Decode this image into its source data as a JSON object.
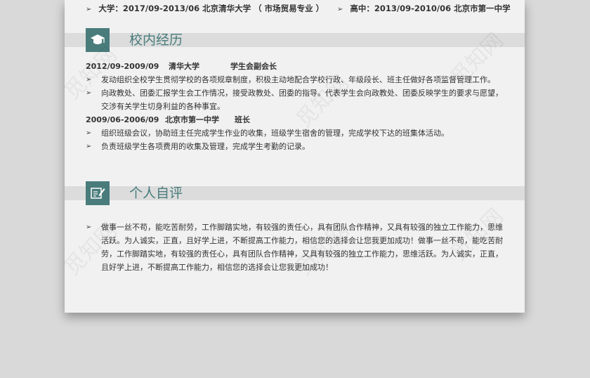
{
  "education": {
    "university": "大学：2017/09-2013/06    北京清华大学 （ 市场贸易专业 ）",
    "highschool": "高中：2013/09-2010/06    北京市第一中学"
  },
  "campus": {
    "title": "校内经历",
    "icon": "graduation-cap-icon",
    "entry1": {
      "date": "2012/09-2009/09",
      "org": "清华大学",
      "role": "学生会副会长",
      "bullets": [
        "发动组织全校学生贯彻学校的各项规章制度，积极主动地配合学校行政、年级段长、班主任做好各项监督管理工作。",
        "向政教处、团委汇报学生会工作情况，接受政教处、团委的指导。代表学生会向政教处、团委反映学生的要求与愿望，",
        "交涉有关学生切身利益的各种事宜。"
      ]
    },
    "entry2": {
      "date": "2009/06-2006/09",
      "org": "北京市第一中学",
      "role": "班长",
      "bullets": [
        "组织班级会议，协助班主任完成学生作业的收集，班级学生宿舍的管理，完成学校下达的班集体活动。",
        "负责班级学生各项费用的收集及管理，完成学生考勤的记录。"
      ]
    }
  },
  "self": {
    "title": "个人自评",
    "icon": "edit-pen-icon",
    "lines": [
      "做事一丝不苟，能吃苦耐劳，工作脚踏实地，有较强的责任心，具有团队合作精神，又具有较强的独立工作能力，思维",
      "活跃。为人诚实，正直，且好学上进，不断提高工作能力，相信您的选择会让您我更加成功！做事一丝不苟，能吃苦耐",
      "劳，工作脚踏实地，有较强的责任心，具有团队合作精神，又具有较强的独立工作能力，思维活跃。为人诚实，正直，",
      "且好学上进，不断提高工作能力，相信您的选择会让您我更加成功！"
    ]
  },
  "bullet_glyph": "➢",
  "watermark": "觅知网",
  "colors": {
    "accent": "#4a7c7c",
    "bar": "#dcdcdc",
    "page": "#f1f1f1",
    "backdrop": "#d9d9d9"
  }
}
